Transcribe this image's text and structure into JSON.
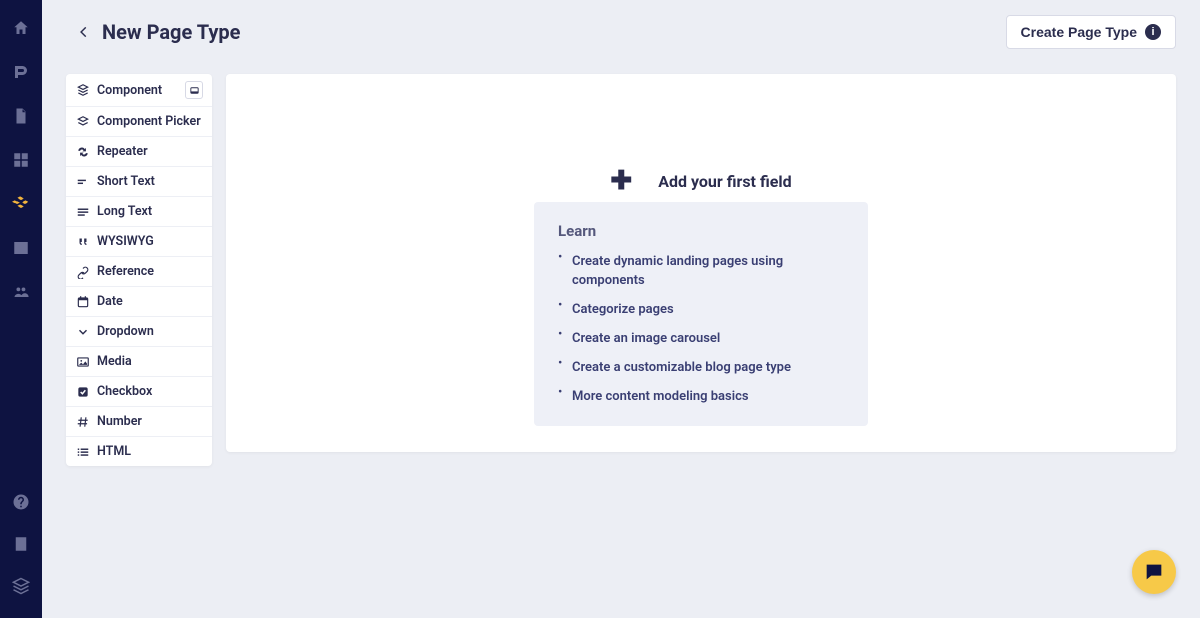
{
  "header": {
    "title": "New Page Type",
    "create_button": "Create Page Type"
  },
  "nav": {
    "items": [
      {
        "name": "home",
        "active": false
      },
      {
        "name": "blog",
        "active": false
      },
      {
        "name": "pages",
        "active": false
      },
      {
        "name": "grid",
        "active": false
      },
      {
        "name": "components",
        "active": true
      },
      {
        "name": "media",
        "active": false
      },
      {
        "name": "users",
        "active": false
      }
    ],
    "bottom_items": [
      {
        "name": "help"
      },
      {
        "name": "docs"
      },
      {
        "name": "layers"
      }
    ]
  },
  "field_types": [
    {
      "label": "Component",
      "icon": "layers",
      "has_toggle": true
    },
    {
      "label": "Component Picker",
      "icon": "layers-picker"
    },
    {
      "label": "Repeater",
      "icon": "repeat"
    },
    {
      "label": "Short Text",
      "icon": "short-text"
    },
    {
      "label": "Long Text",
      "icon": "long-text"
    },
    {
      "label": "WYSIWYG",
      "icon": "quote"
    },
    {
      "label": "Reference",
      "icon": "link"
    },
    {
      "label": "Date",
      "icon": "calendar"
    },
    {
      "label": "Dropdown",
      "icon": "chevron"
    },
    {
      "label": "Media",
      "icon": "image"
    },
    {
      "label": "Checkbox",
      "icon": "checkbox"
    },
    {
      "label": "Number",
      "icon": "hash"
    },
    {
      "label": "HTML",
      "icon": "list"
    }
  ],
  "canvas": {
    "add_prompt": "Add your first field"
  },
  "learn": {
    "title": "Learn",
    "links": [
      "Create dynamic landing pages using components",
      "Categorize pages",
      "Create an image carousel",
      "Create a customizable blog page type",
      "More content modeling basics"
    ]
  }
}
